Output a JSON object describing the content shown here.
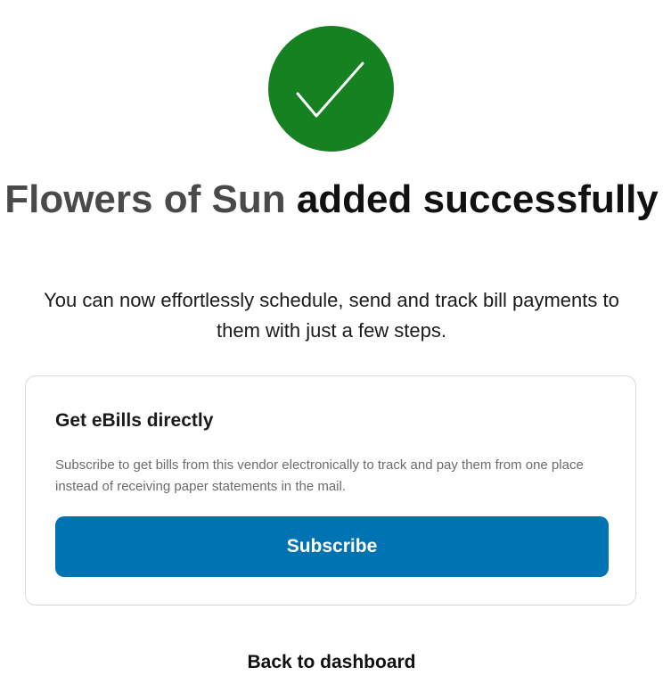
{
  "icon": "checkmark-circle-icon",
  "colors": {
    "success": "#158121",
    "primary_button": "#0073b3",
    "vendor_text": "#4a4a4a"
  },
  "headline": {
    "vendor": "Flowers of Sun",
    "status": "added successfully"
  },
  "subtext": "You can now effortlessly schedule, send and track bill payments to them with just a few steps.",
  "ebills_card": {
    "title": "Get eBills directly",
    "description": "Subscribe to get bills from this vendor electronically to track and pay them from one place instead of receiving paper statements in the mail.",
    "button_label": "Subscribe"
  },
  "footer": {
    "back_link": "Back to dashboard"
  }
}
